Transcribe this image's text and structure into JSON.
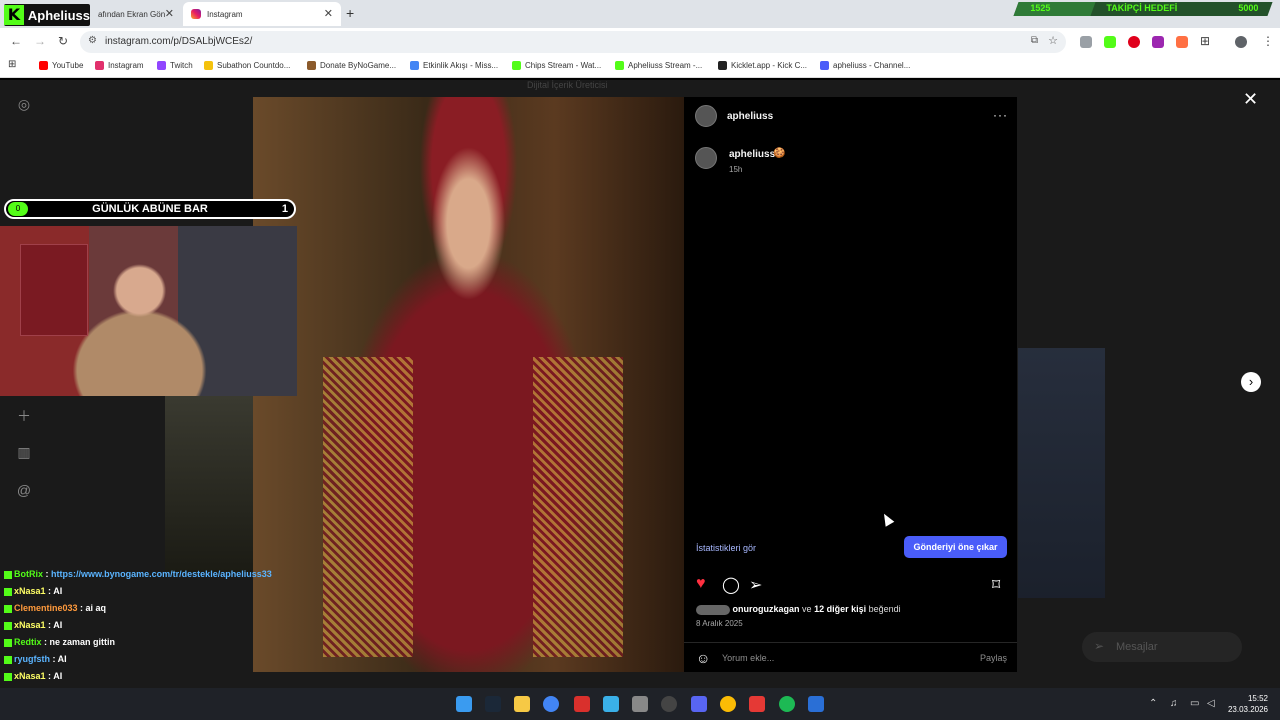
{
  "browser": {
    "tabs": [
      {
        "label": "afından Ekran Gön",
        "active": false
      },
      {
        "label": "Instagram",
        "active": true
      }
    ],
    "close_glyph": "✕",
    "new_tab_glyph": "+",
    "url": "instagram.com/p/DSALbjWCEs2/",
    "bookmarks": [
      {
        "label": "YouTube",
        "color": "#ff0000"
      },
      {
        "label": "Instagram",
        "color": "#e1306c"
      },
      {
        "label": "Twitch",
        "color": "#9146ff"
      },
      {
        "label": "Subathon Countdo...",
        "color": "#f4c20d"
      },
      {
        "label": "Donate ByNoGame...",
        "color": "#8b5a2b"
      },
      {
        "label": "Etkinlik Akışı - Miss...",
        "color": "#4285f4"
      },
      {
        "label": "Chips Stream - Wat...",
        "color": "#53fc18"
      },
      {
        "label": "Apheliuss Stream -...",
        "color": "#53fc18"
      },
      {
        "label": "Kicklet.app - Kick C...",
        "color": "#222222"
      },
      {
        "label": "apheliuss - Channel...",
        "color": "#4a5df9"
      }
    ]
  },
  "stream_overlay": {
    "kick_logo": "K",
    "channel_name": "Apheliuss",
    "follower_goal": {
      "current": "1525",
      "label": "TAKİPÇİ HEDEFİ",
      "target": "5000",
      "progress": 0.305
    },
    "sub_bar": {
      "label": "GÜNLÜK ABÜNE BAR",
      "count": "1",
      "indicator": "0"
    },
    "chat": [
      {
        "user": "BotRix",
        "user_color": "#53fc18",
        "message": "https://www.bynogame.com/tr/destekle/apheliuss33",
        "msg_color": "#5ab4ff"
      },
      {
        "user": "xNasa1",
        "user_color": "#ffff66",
        "message": "AI",
        "msg_color": "#ffffff"
      },
      {
        "user": "Clementine033",
        "user_color": "#ff9a3c",
        "message": "ai aq",
        "msg_color": "#ffffff"
      },
      {
        "user": "xNasa1",
        "user_color": "#ffff66",
        "message": "AI",
        "msg_color": "#ffffff"
      },
      {
        "user": "Redtix",
        "user_color": "#53fc18",
        "message": "ne zaman gittin",
        "msg_color": "#ffffff"
      },
      {
        "user": "ryugfsth",
        "user_color": "#5ab4ff",
        "message": "AI",
        "msg_color": "#ffffff"
      },
      {
        "user": "xNasa1",
        "user_color": "#ffff66",
        "message": "AI",
        "msg_color": "#ffffff"
      },
      {
        "user": "xNasa1",
        "user_color": "#ffff66",
        "message": "AI",
        "msg_color": "#ffffff"
      },
      {
        "user": "ryugfsth",
        "user_color": "#5ab4ff",
        "message": "",
        "msg_color": "#ffffff"
      }
    ]
  },
  "instagram": {
    "faded_header_text": "Dijital İçerik Üreticisi",
    "post": {
      "author": "apheliuss",
      "more_glyph": "···",
      "caption_user": "apheliuss",
      "caption_emoji": "🍪",
      "time_ago": "15h",
      "stats_link": "İstatistikleri gör",
      "boost_button": "Gönderiyi öne çıkar",
      "liked_by_user": "onuroguzkagan",
      "liked_by_conj": "ve",
      "liked_by_others": "12 diğer kişi",
      "liked_by_suffix": "beğendi",
      "date": "8 Aralık 2025",
      "comment_placeholder": "Yorum ekle...",
      "share_label": "Paylaş"
    },
    "messages_label": "Mesajlar",
    "close_glyph": "✕",
    "next_glyph": "›"
  },
  "taskbar": {
    "time": "15:52",
    "date": "23.03.2026"
  }
}
